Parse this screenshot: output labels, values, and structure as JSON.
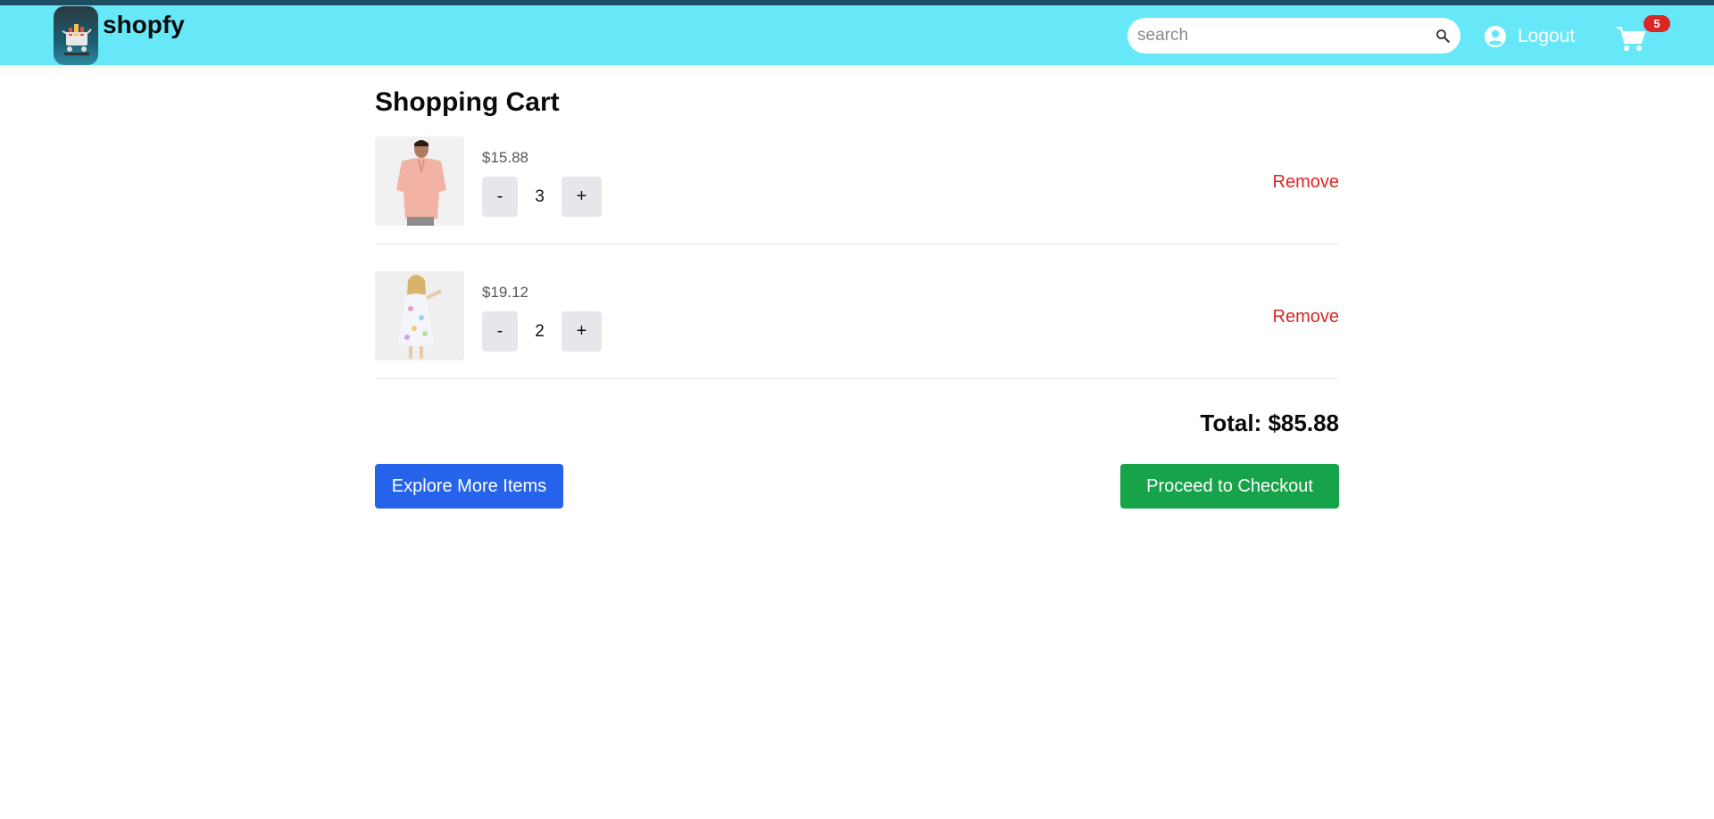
{
  "app": {
    "brand": "shopfy"
  },
  "header": {
    "search_placeholder": "search",
    "logout_label": "Logout",
    "cart_count": "5"
  },
  "main": {
    "title": "Shopping Cart",
    "items": [
      {
        "price": "$15.88",
        "qty_minus": "-",
        "quantity": "3",
        "qty_plus": "+",
        "remove_label": "Remove",
        "image": "man-in-pink-shirt"
      },
      {
        "price": "$19.12",
        "qty_minus": "-",
        "quantity": "2",
        "qty_plus": "+",
        "remove_label": "Remove",
        "image": "girl-in-floral-dress"
      }
    ],
    "total": "Total: $85.88",
    "explore_label": "Explore More Items",
    "checkout_label": "Proceed to Checkout"
  },
  "colors": {
    "navbar": "#67e8f9",
    "explore_button": "#2563eb",
    "checkout_button": "#16a34a",
    "remove_link": "#dc2626",
    "badge": "#dc2626"
  },
  "icons": [
    "search-icon",
    "user-circle-icon",
    "cart-icon"
  ]
}
